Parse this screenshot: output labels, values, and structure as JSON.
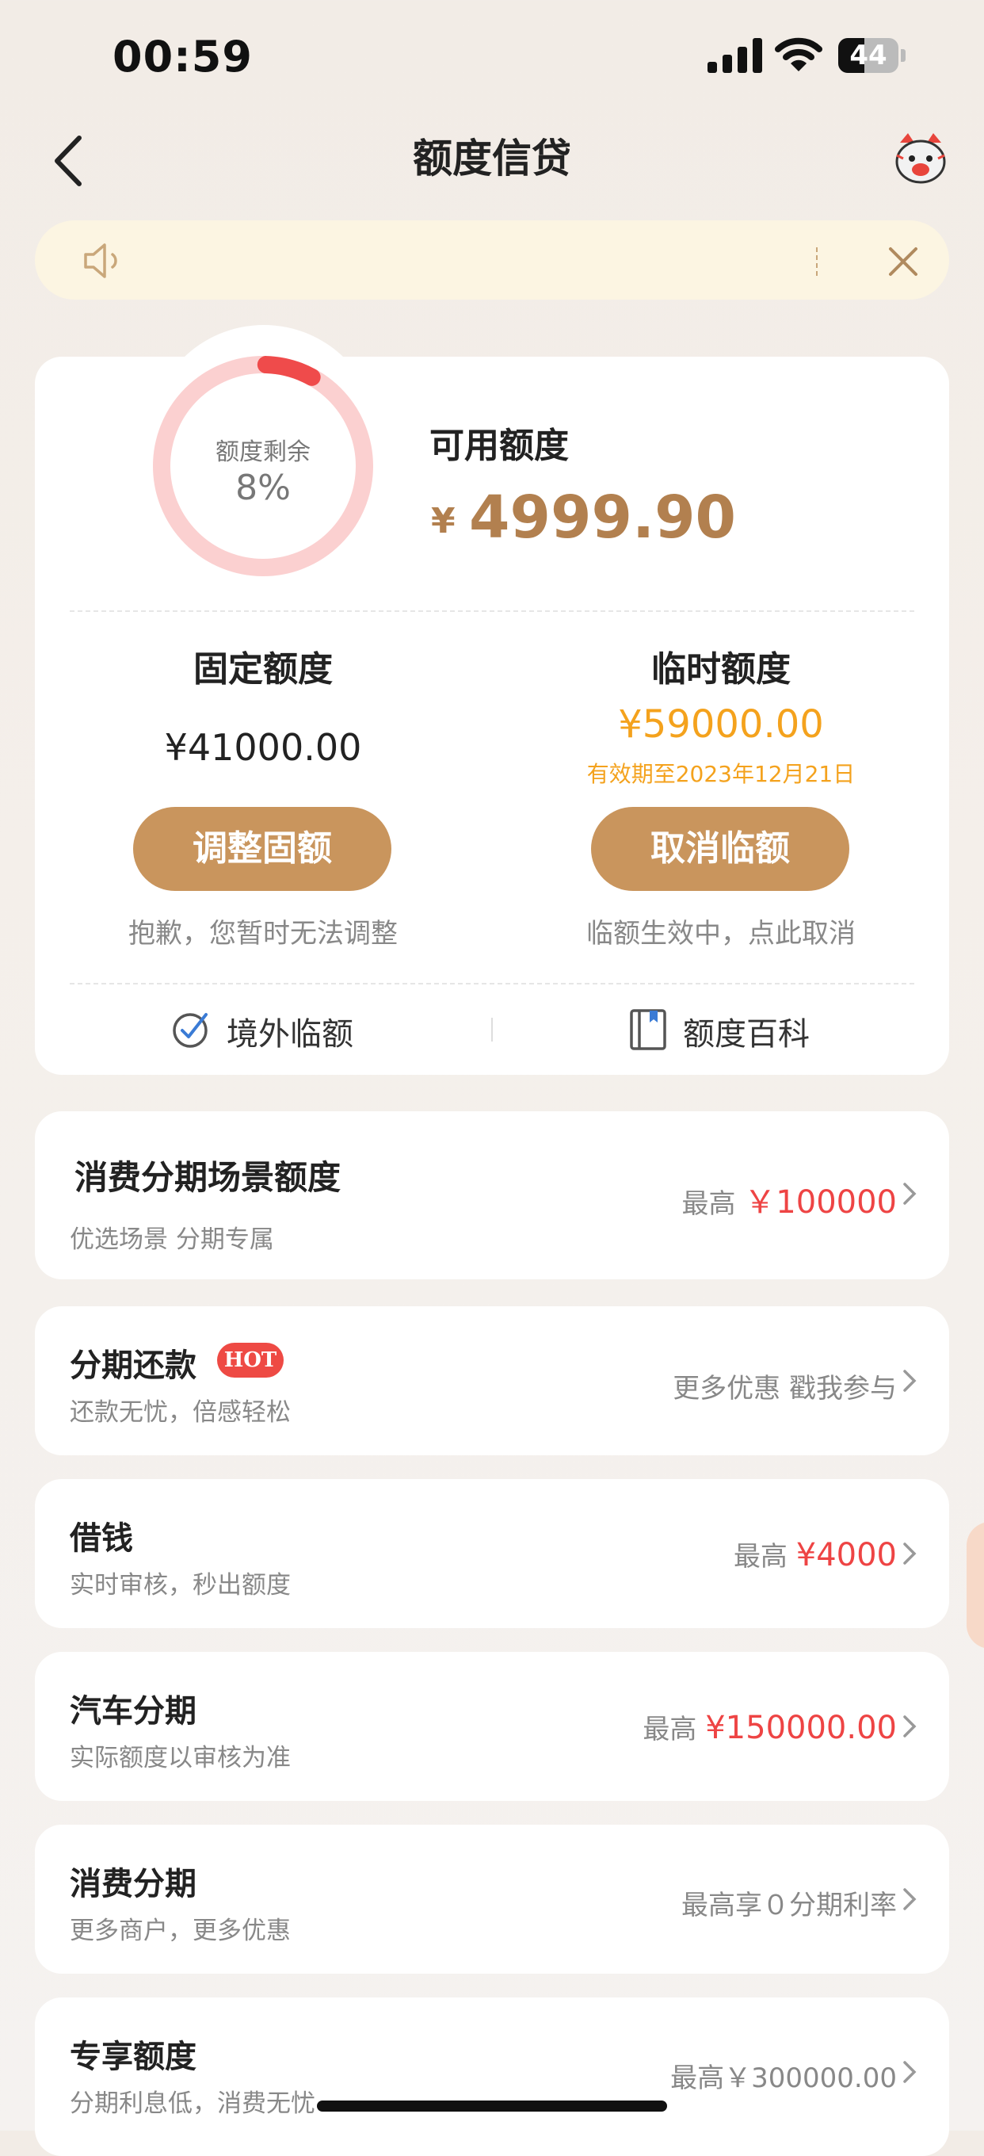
{
  "status_bar": {
    "time": "00:59",
    "battery": "44"
  },
  "nav": {
    "title": "额度信贷"
  },
  "summary": {
    "ring_label": "额度剩余",
    "ring_percent": "8%",
    "ring_fraction": 0.08,
    "available_label": "可用额度",
    "currency": "¥",
    "available_amount": "4999.90"
  },
  "fixed": {
    "title": "固定额度",
    "amount": "¥41000.00",
    "button": "调整固额",
    "note": "抱歉，您暂时无法调整"
  },
  "temporary": {
    "title": "临时额度",
    "amount": "¥59000.00",
    "validity": "有效期至2023年12月21日",
    "button": "取消临额",
    "note": "临额生效中，点此取消"
  },
  "quick_links": {
    "overseas": "境外临额",
    "encyclopedia": "额度百科"
  },
  "items": [
    {
      "title": "消费分期场景额度",
      "subtitle": "优选场景 分期专属",
      "right_prefix": "最高 ",
      "right_value": "￥100000"
    },
    {
      "title": "分期还款",
      "badge": "HOT",
      "subtitle": "还款无忧，倍感轻松",
      "right_text": "更多优惠 戳我参与"
    },
    {
      "title": "借钱",
      "subtitle": "实时审核，秒出额度",
      "right_prefix": "最高 ",
      "right_value": "¥4000"
    },
    {
      "title": "汽车分期",
      "subtitle": "实际额度以审核为准",
      "right_prefix": "最高 ",
      "right_value": "¥150000.00"
    },
    {
      "title": "消费分期",
      "subtitle": "更多商户，更多优惠",
      "right_text": "最高享０分期利率"
    },
    {
      "title": "专享额度",
      "subtitle": "分期利息低，消费无忧",
      "right_text": "最高￥300000.00"
    }
  ],
  "colors": {
    "accent": "#c9955d",
    "amount": "#b2804f",
    "red": "#ee4444",
    "orange": "#f4a21d"
  }
}
